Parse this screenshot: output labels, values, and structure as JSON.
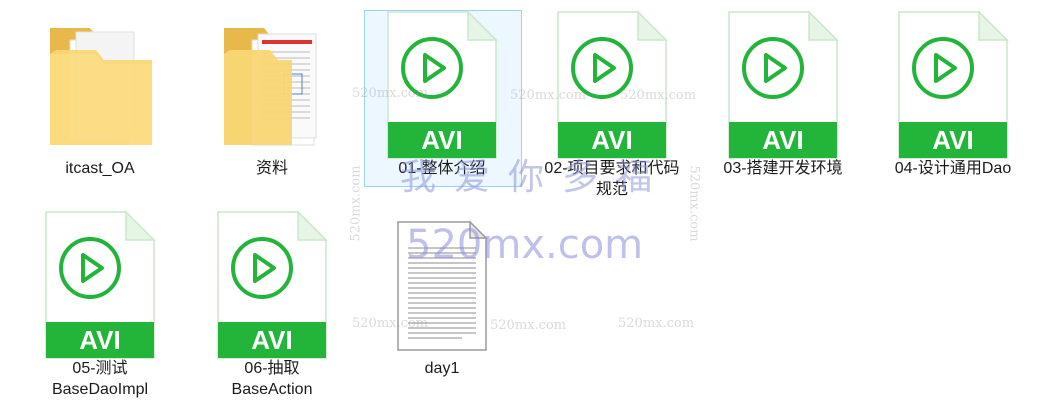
{
  "items": [
    {
      "id": "itcast",
      "type": "folder",
      "label": "itcast_OA"
    },
    {
      "id": "ziliao",
      "type": "folder-doc",
      "label": "资料"
    },
    {
      "id": "v01",
      "type": "avi",
      "badge": "AVI",
      "label": "01-整体介绍"
    },
    {
      "id": "v02",
      "type": "avi",
      "badge": "AVI",
      "label": "02-项目要求和代码规范"
    },
    {
      "id": "v03",
      "type": "avi",
      "badge": "AVI",
      "label": "03-搭建开发环境"
    },
    {
      "id": "v04",
      "type": "avi",
      "badge": "AVI",
      "label": "04-设计通用Dao"
    },
    {
      "id": "v05",
      "type": "avi",
      "badge": "AVI",
      "label": "05-测试BaseDaoImpl"
    },
    {
      "id": "v06",
      "type": "avi",
      "badge": "AVI",
      "label": "06-抽取BaseAction"
    },
    {
      "id": "day1",
      "type": "text",
      "label": "day1"
    }
  ],
  "watermark": {
    "cn": "我爱你多福",
    "en": "520mx.com",
    "small": "520mx.com"
  },
  "colors": {
    "avi_green": "#22b53a",
    "folder": "#f8d673"
  }
}
